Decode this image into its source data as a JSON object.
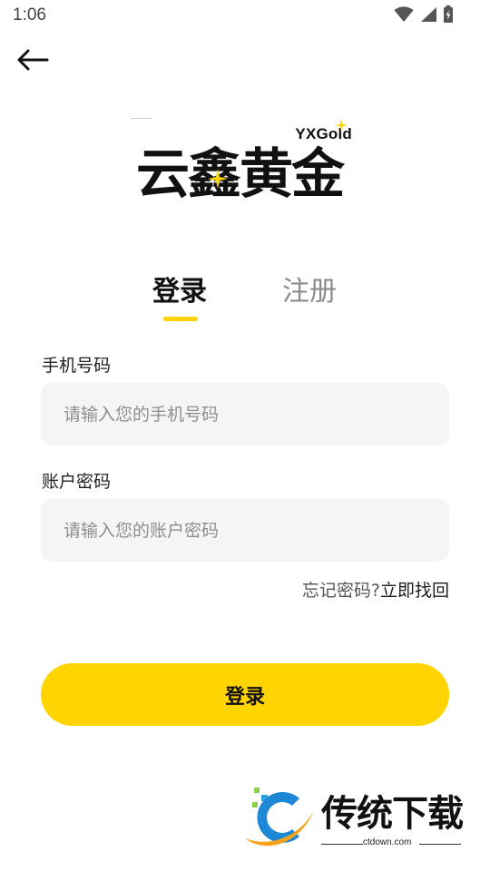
{
  "status_bar": {
    "time": "1:06"
  },
  "logo": {
    "sub_text": "YXGold",
    "main_text": "云鑫黄金"
  },
  "tabs": [
    {
      "label": "登录",
      "active": true
    },
    {
      "label": "注册",
      "active": false
    }
  ],
  "phone": {
    "label": "手机号码",
    "placeholder": "请输入您的手机号码"
  },
  "password": {
    "label": "账户密码",
    "placeholder": "请输入您的账户密码"
  },
  "forgot": {
    "question": "忘记密码?",
    "link": "立即找回"
  },
  "submit": {
    "label": "登录"
  },
  "watermark": {
    "title": "传统下载",
    "url": "ctdown.com"
  },
  "colors": {
    "accent": "#ffd400",
    "input_bg": "#f5f5f5",
    "muted_text": "#8c8c8c"
  },
  "icons": [
    "wifi-icon",
    "signal-icon",
    "battery-icon",
    "back-arrow-icon",
    "sparkle-icon"
  ]
}
